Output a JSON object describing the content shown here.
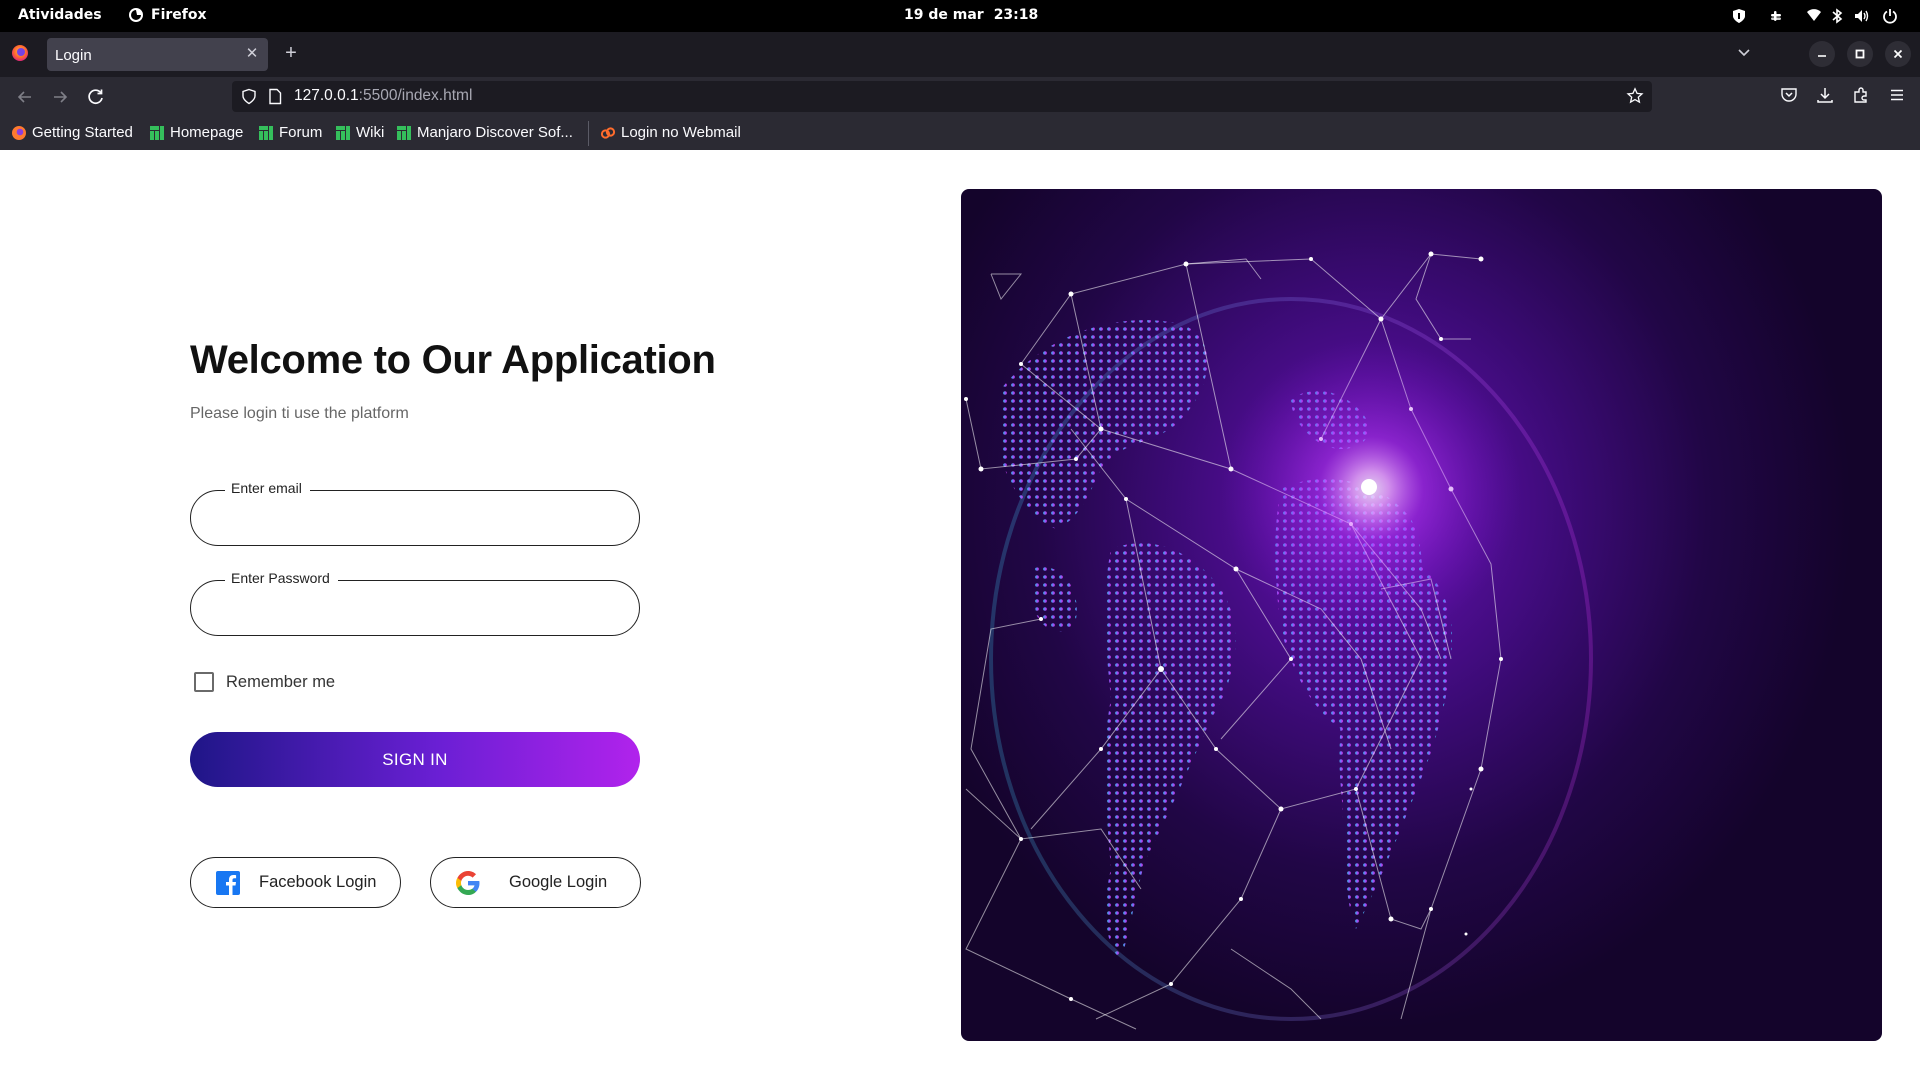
{
  "system_bar": {
    "activities": "Atividades",
    "app_name": "Firefox",
    "date": "19 de mar",
    "time": "23:18"
  },
  "browser": {
    "tab_title": "Login",
    "url_host": "127.0.0.1",
    "url_path": ":5500/index.html",
    "bookmarks": [
      {
        "label": "Getting Started",
        "icon": "firefox-icon"
      },
      {
        "label": "Homepage",
        "icon": "manjaro-icon"
      },
      {
        "label": "Forum",
        "icon": "manjaro-icon"
      },
      {
        "label": "Wiki",
        "icon": "manjaro-icon"
      },
      {
        "label": "Manjaro Discover Sof...",
        "icon": "manjaro-icon"
      },
      {
        "label": "Login no Webmail",
        "icon": "webmail-icon"
      }
    ]
  },
  "login": {
    "title": "Welcome to Our Application",
    "subtitle": "Please login ti use the platform",
    "email_label": "Enter email",
    "email_value": "",
    "password_label": "Enter Password",
    "password_value": "",
    "remember_label": "Remember me",
    "remember_checked": false,
    "signin_label": "SIGN IN",
    "facebook_label": "Facebook Login",
    "google_label": "Google Login"
  },
  "colors": {
    "signin_gradient_start": "#1f1687",
    "signin_gradient_end": "#b123ec",
    "hero_background": "#2a0855",
    "facebook_blue": "#1877f2"
  }
}
